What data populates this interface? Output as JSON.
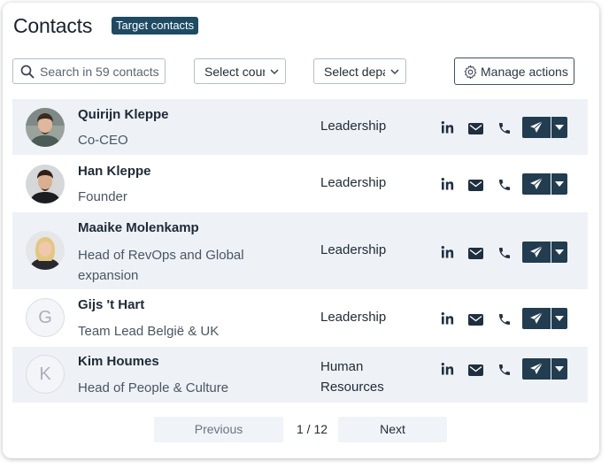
{
  "header": {
    "title": "Contacts",
    "badge": "Target contacts"
  },
  "filters": {
    "search_placeholder": "Search in 59 contacts",
    "country_select": "Select country",
    "department_select": "Select department",
    "manage_actions": "Manage actions"
  },
  "contacts": [
    {
      "name": "Quirijn Kleppe",
      "role": "Co-CEO",
      "department": "Leadership",
      "avatar": "photo",
      "initial": ""
    },
    {
      "name": "Han Kleppe",
      "role": "Founder",
      "department": "Leadership",
      "avatar": "photo",
      "initial": ""
    },
    {
      "name": "Maaike Molenkamp",
      "role": "Head of RevOps and Global expansion",
      "department": "Leadership",
      "avatar": "photo",
      "initial": ""
    },
    {
      "name": "Gijs 't Hart",
      "role": "Team Lead België & UK",
      "department": "Leadership",
      "avatar": "placeholder",
      "initial": "G"
    },
    {
      "name": "Kim Houmes",
      "role": "Head of People & Culture",
      "department": "Human Resources",
      "avatar": "placeholder",
      "initial": "K"
    }
  ],
  "pagination": {
    "previous": "Previous",
    "page": "1 / 12",
    "next": "Next"
  },
  "colors": {
    "accent": "#223c50",
    "badge": "#1e4b63",
    "row_alt": "#eef2f7"
  }
}
